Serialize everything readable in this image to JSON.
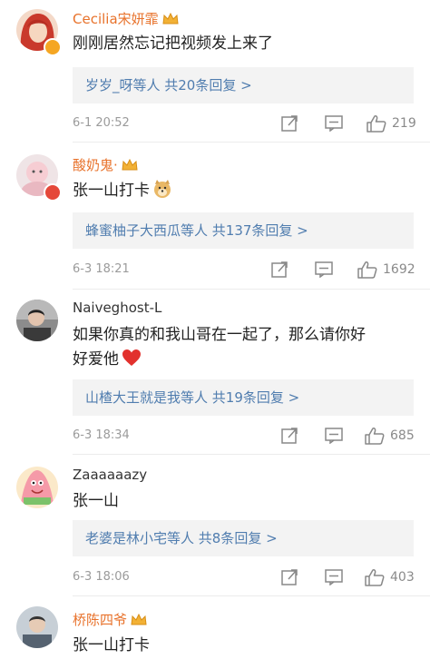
{
  "comments": [
    {
      "name": "Cecilia宋妍霏",
      "name_color": "#e8722b",
      "text": "刚刚居然忘记把视频发上来了",
      "replies": "岁岁_呀等人  共20条回复 >",
      "time": "6-1 20:52",
      "likes": "219",
      "badge": "verified-orange",
      "avatar": "red-hair-avatar"
    },
    {
      "name": "酸奶鬼·",
      "name_color": "#e8722b",
      "text": "张一山打卡",
      "replies": "蜂蜜柚子大西瓜等人  共137条回复 >",
      "time": "6-3 18:21",
      "likes": "1692",
      "badge": "verified-red",
      "avatar": "pink-avatar"
    },
    {
      "name": "Naiveghost-L",
      "name_color": "#333333",
      "text_line1": "如果你真的和我山哥在一起了，那么请你好",
      "text_line2": "好爱他",
      "replies": "山楂大王就是我等人  共19条回复 >",
      "time": "6-3 18:34",
      "likes": "685",
      "avatar": "dark-photo-avatar"
    },
    {
      "name": "Zaaaaaazy",
      "name_color": "#333333",
      "text": "张一山",
      "replies": "老婆是林小宅等人  共8条回复 >",
      "time": "6-3 18:06",
      "likes": "403",
      "avatar": "patrick-star-avatar"
    },
    {
      "name": "桥陈四爷",
      "name_color": "#e8722b",
      "text": "张一山打卡",
      "avatar": "photo-avatar"
    }
  ],
  "icons": {
    "crown": "vip-crown-icon",
    "dog_emoji": "doge-emoji-icon",
    "heart_emoji": "red-heart-emoji-icon",
    "forward": "forward-icon",
    "comment": "comment-icon",
    "like": "thumbs-up-icon"
  },
  "colors": {
    "link": "#507daf",
    "meta": "#9b9b9b",
    "reply_bg": "#f3f3f3",
    "name_vip": "#e8722b"
  }
}
